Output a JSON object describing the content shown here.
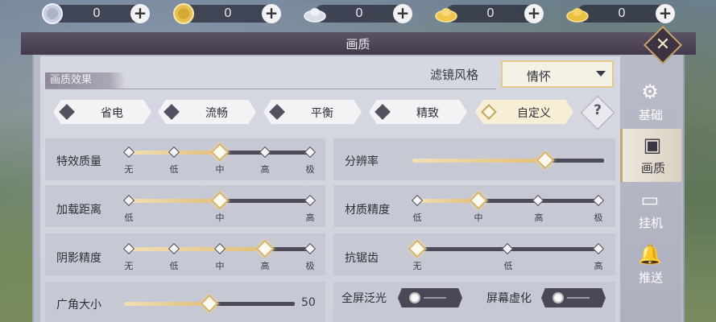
{
  "currencies": [
    {
      "icon": "silver-coin-icon",
      "value": "0",
      "color": "#c9cfe0"
    },
    {
      "icon": "gold-coin-icon",
      "value": "0",
      "color": "#e7c150"
    },
    {
      "icon": "silver-ingot-icon",
      "value": "0",
      "color": "#d8dee8"
    },
    {
      "icon": "gold-ingot-icon",
      "value": "0",
      "color": "#f0c64a"
    },
    {
      "icon": "gold-ingot-icon",
      "value": "0",
      "color": "#e9c040"
    }
  ],
  "window": {
    "title": "画质"
  },
  "section": {
    "title": "画质效果"
  },
  "filter": {
    "label": "滤镜风格",
    "value": "情怀"
  },
  "presets": [
    {
      "label": "省电",
      "active": false
    },
    {
      "label": "流畅",
      "active": false
    },
    {
      "label": "平衡",
      "active": false
    },
    {
      "label": "精致",
      "active": false
    },
    {
      "label": "自定义",
      "active": true
    }
  ],
  "help": {
    "label": "?"
  },
  "settings": {
    "effect_quality": {
      "label": "特效质量",
      "ticks": [
        "无",
        "低",
        "中",
        "高",
        "极"
      ],
      "value": "中"
    },
    "load_distance": {
      "label": "加载距离",
      "ticks": [
        "低",
        "中",
        "高"
      ],
      "value": "中"
    },
    "shadow_quality": {
      "label": "阴影精度",
      "ticks": [
        "无",
        "低",
        "中",
        "高",
        "极"
      ],
      "value": "高"
    },
    "fov": {
      "label": "广角大小",
      "value": "50"
    },
    "resolution": {
      "label": "分辨率",
      "level": 0.68
    },
    "texture_quality": {
      "label": "材质精度",
      "ticks": [
        "低",
        "中",
        "高",
        "极"
      ],
      "value": "中"
    },
    "antialias": {
      "label": "抗锯齿",
      "ticks": [
        "无",
        "低",
        "高"
      ],
      "value": "无"
    },
    "bloom": {
      "label": "全屏泛光",
      "on": false
    },
    "screen_blur": {
      "label": "屏幕虚化",
      "on": false
    }
  },
  "tabs": [
    {
      "label": "基础",
      "icon": "gear-icon",
      "active": false
    },
    {
      "label": "画质",
      "icon": "picture-icon",
      "active": true
    },
    {
      "label": "挂机",
      "icon": "monitor-icon",
      "active": false
    },
    {
      "label": "推送",
      "icon": "bell-icon",
      "active": false
    }
  ]
}
